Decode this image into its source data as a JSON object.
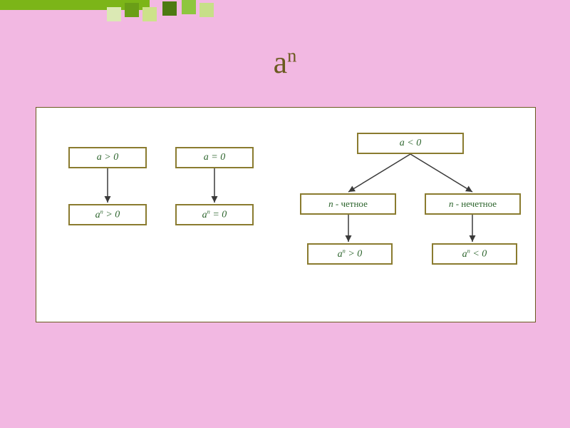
{
  "title_base": "a",
  "title_exp": "n",
  "boxes": {
    "a_pos": {
      "html": "<i>a</i> &gt; 0"
    },
    "an_pos": {
      "html": "<i>a<sup>n</sup></i> &gt; 0"
    },
    "a_zero": {
      "html": "<i>a</i> = 0"
    },
    "an_zero": {
      "html": "<i>a<sup>n</sup></i> = 0"
    },
    "a_neg": {
      "html": "<i>a</i> &lt; 0"
    },
    "n_even": {
      "html": "<i>n</i> - <span class='nonitalic'>четное</span>"
    },
    "n_odd": {
      "html": "<i>n</i> - <span class='nonitalic'>нечетное</span>"
    },
    "an_pos2": {
      "html": "<i>a<sup>n</sup></i> &gt; 0"
    },
    "an_neg": {
      "html": "<i>a<sup>n</sup></i> &lt; 0"
    }
  },
  "chart_data": {
    "type": "diagram",
    "title": "a^n sign analysis",
    "nodes": [
      {
        "id": "a_pos",
        "label": "a > 0"
      },
      {
        "id": "an_pos",
        "label": "a^n > 0"
      },
      {
        "id": "a_zero",
        "label": "a = 0"
      },
      {
        "id": "an_zero",
        "label": "a^n = 0"
      },
      {
        "id": "a_neg",
        "label": "a < 0"
      },
      {
        "id": "n_even",
        "label": "n - четное"
      },
      {
        "id": "n_odd",
        "label": "n - нечетное"
      },
      {
        "id": "an_pos2",
        "label": "a^n > 0"
      },
      {
        "id": "an_neg",
        "label": "a^n < 0"
      }
    ],
    "edges": [
      {
        "from": "a_pos",
        "to": "an_pos"
      },
      {
        "from": "a_zero",
        "to": "an_zero"
      },
      {
        "from": "a_neg",
        "to": "n_even"
      },
      {
        "from": "a_neg",
        "to": "n_odd"
      },
      {
        "from": "n_even",
        "to": "an_pos2"
      },
      {
        "from": "n_odd",
        "to": "an_neg"
      }
    ]
  }
}
